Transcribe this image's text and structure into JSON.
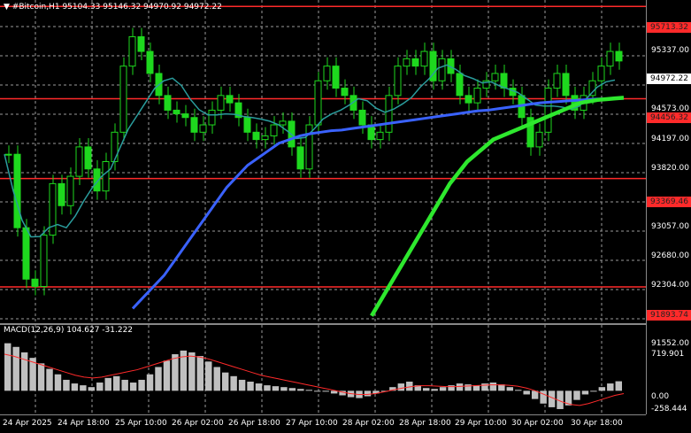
{
  "header": {
    "arrow": "▼",
    "symbol": "#Bitcoin,H1",
    "ohlc": "95104.33 95146.32 94970.92 94972.22"
  },
  "macd": {
    "label": "MACD(12,26,9) 104.627 -31.222"
  },
  "price_axis": {
    "ticks": [
      "95337.00",
      "94573.00",
      "94197.00",
      "93820.00",
      "93057.00",
      "92680.00",
      "92304.00",
      "91552.00"
    ],
    "levels": [
      "95713.32",
      "94456.32",
      "93369.46",
      "91893.74"
    ],
    "current": "94972.22"
  },
  "macd_axis": {
    "ticks": [
      "719.901",
      "0.00",
      "-258.444"
    ]
  },
  "time_axis": {
    "labels": [
      "24 Apr 2025",
      "24 Apr 18:00",
      "25 Apr 10:00",
      "26 Apr 02:00",
      "26 Apr 18:00",
      "27 Apr 10:00",
      "28 Apr 02:00",
      "28 Apr 18:00",
      "29 Apr 10:00",
      "30 Apr 02:00",
      "30 Apr 18:00"
    ]
  },
  "colors": {
    "background": "#000000",
    "candles": "#1ed81e",
    "level_lines": "#ff2a2a",
    "ma_fast": "#2a9d9d",
    "ma_mid": "#3a62ff",
    "ma_slow": "#2ee82e",
    "macd_hist": "#c0c0c0",
    "macd_signal": "#ff2a2a",
    "grid": "#9a9a9a"
  },
  "chart_data": {
    "type": "line",
    "y_range": [
      91400,
      95800
    ],
    "levels": [
      95713.32,
      94456.32,
      93369.46,
      91893.74
    ],
    "series": [
      {
        "values": [
          93700,
          92700,
          92000,
          91900,
          92600,
          93300,
          93000,
          93400,
          93800,
          93500,
          93200,
          93600,
          94000,
          94900,
          95300,
          95100,
          94800,
          94500,
          94300,
          94250,
          94200,
          94000,
          94100,
          94300,
          94500,
          94400,
          94200,
          94000,
          93900,
          93950,
          94100,
          94150,
          93800,
          93500,
          94100,
          94700,
          94900,
          94600,
          94500,
          94300,
          94100,
          93900,
          94000,
          94500,
          94900,
          95000,
          94900,
          95100,
          94700,
          95000,
          94800,
          94500,
          94400,
          94600,
          94700,
          94800,
          94600,
          94500,
          94200,
          93800,
          94000,
          94600,
          94800,
          94500,
          94300,
          94500,
          94700,
          94900,
          95100,
          94970
        ]
      },
      {
        "values": [
          91600,
          91750,
          91900,
          92050,
          92250,
          92450,
          92650,
          92850,
          93050,
          93250,
          93400,
          93550,
          93650,
          93750,
          93850,
          93900,
          93950,
          93980,
          94000,
          94020,
          94030,
          94050,
          94070,
          94090,
          94110,
          94130,
          94150,
          94170,
          94190,
          94210,
          94230,
          94250,
          94270,
          94290,
          94300,
          94320,
          94340,
          94360,
          94380,
          94400,
          94410,
          94420,
          94430,
          94440,
          94450,
          94455,
          94458,
          94460
        ]
      },
      {
        "values": [
          91500,
          91700,
          91900,
          92100,
          92300,
          92500,
          92700,
          92900,
          93100,
          93300,
          93450,
          93600,
          93700,
          93800,
          93900,
          93950,
          94000,
          94050,
          94100,
          94150,
          94200,
          94250,
          94300,
          94350,
          94400,
          94420,
          94440,
          94450,
          94460,
          94470
        ]
      }
    ],
    "macd": {
      "y_range": [
        -258.444,
        719.901
      ],
      "histogram": [
        520,
        480,
        420,
        360,
        300,
        240,
        180,
        120,
        80,
        60,
        40,
        90,
        140,
        160,
        120,
        90,
        120,
        180,
        260,
        330,
        400,
        440,
        420,
        380,
        320,
        260,
        200,
        160,
        120,
        100,
        80,
        60,
        50,
        40,
        30,
        20,
        10,
        0,
        -10,
        -30,
        -50,
        -70,
        -80,
        -60,
        -30,
        0,
        40,
        80,
        100,
        60,
        30,
        20,
        40,
        60,
        80,
        70,
        60,
        80,
        90,
        70,
        40,
        10,
        -40,
        -90,
        -140,
        -180,
        -200,
        -160,
        -100,
        -40,
        0,
        40,
        80,
        104
      ],
      "signal": [
        400,
        380,
        350,
        320,
        290,
        260,
        230,
        200,
        170,
        150,
        140,
        150,
        170,
        190,
        210,
        230,
        260,
        290,
        320,
        350,
        370,
        380,
        370,
        350,
        320,
        290,
        260,
        230,
        200,
        170,
        150,
        130,
        110,
        90,
        70,
        50,
        30,
        10,
        -10,
        -30,
        -40,
        -40,
        -30,
        -10,
        10,
        30,
        45,
        55,
        55,
        50,
        45,
        45,
        50,
        55,
        60,
        65,
        65,
        60,
        50,
        30,
        0,
        -40,
        -80,
        -120,
        -150,
        -160,
        -140,
        -110,
        -80,
        -50,
        -31
      ]
    }
  }
}
